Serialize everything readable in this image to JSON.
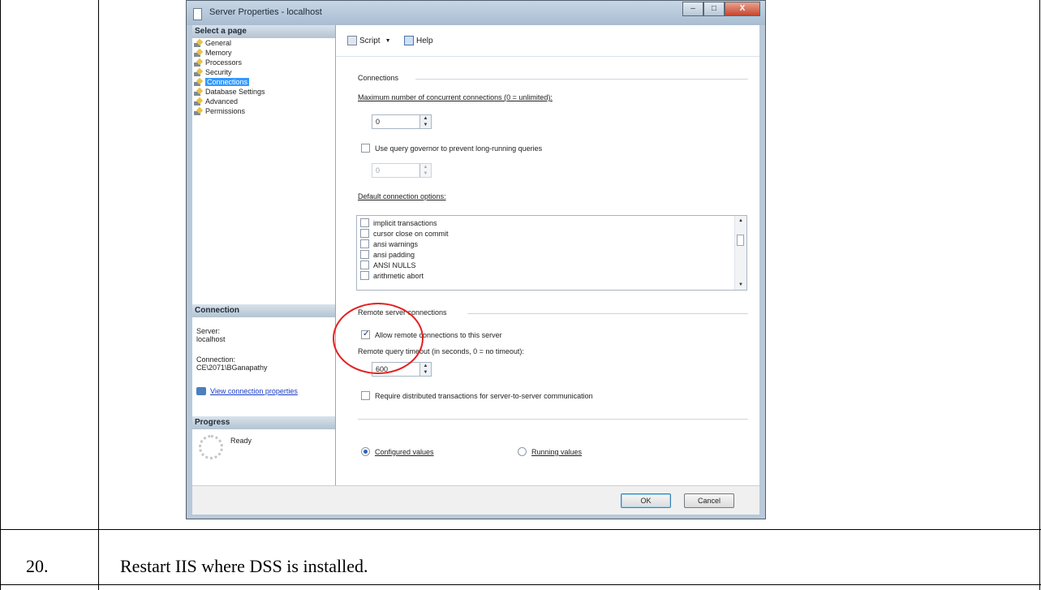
{
  "document": {
    "step_number": "20.",
    "step_text": "Restart IIS where DSS is installed."
  },
  "dialog": {
    "title": "Server Properties - localhost",
    "controls": {
      "minimize": "–",
      "maximize": "□",
      "close": "X"
    },
    "left": {
      "select_page_header": "Select a page",
      "pages": [
        {
          "label": "General",
          "selected": false
        },
        {
          "label": "Memory",
          "selected": false
        },
        {
          "label": "Processors",
          "selected": false
        },
        {
          "label": "Security",
          "selected": false
        },
        {
          "label": "Connections",
          "selected": true
        },
        {
          "label": "Database Settings",
          "selected": false
        },
        {
          "label": "Advanced",
          "selected": false
        },
        {
          "label": "Permissions",
          "selected": false
        }
      ],
      "connection_header": "Connection",
      "server_label": "Server:",
      "server_value": "localhost",
      "connection_label": "Connection:",
      "connection_value": "CE\\2071\\BGanapathy",
      "view_connection_link": "View connection properties",
      "progress_header": "Progress",
      "progress_status": "Ready"
    },
    "toolbar": {
      "script_label": "Script",
      "script_icon": "script-icon",
      "help_label": "Help",
      "help_icon": "help-icon"
    },
    "connections": {
      "section_title": "Connections",
      "max_connections_label": "Maximum number of concurrent connections (0 = unlimited):",
      "max_connections_value": "0",
      "query_governor_label": "Use query governor to prevent long-running queries",
      "query_governor_checked": false,
      "query_governor_value": "0",
      "default_options_label": "Default connection options:",
      "default_options": [
        {
          "label": "implicit transactions",
          "checked": false
        },
        {
          "label": "cursor close on commit",
          "checked": false
        },
        {
          "label": "ansi warnings",
          "checked": false
        },
        {
          "label": "ansi padding",
          "checked": false
        },
        {
          "label": "ANSI NULLS",
          "checked": false
        },
        {
          "label": "arithmetic abort",
          "checked": false
        }
      ]
    },
    "remote": {
      "section_title": "Remote server connections",
      "allow_remote_label": "Allow remote connections to this server",
      "allow_remote_checked": true,
      "timeout_label": "Remote query timeout (in seconds, 0 = no timeout):",
      "timeout_value": "600",
      "require_distributed_label": "Require distributed transactions for server-to-server communication",
      "require_distributed_checked": false
    },
    "values_mode": {
      "configured_label": "Configured values",
      "running_label": "Running values",
      "selected": "configured"
    },
    "buttons": {
      "ok_label": "OK",
      "cancel_label": "Cancel"
    },
    "annotation_color": "#e32020"
  }
}
